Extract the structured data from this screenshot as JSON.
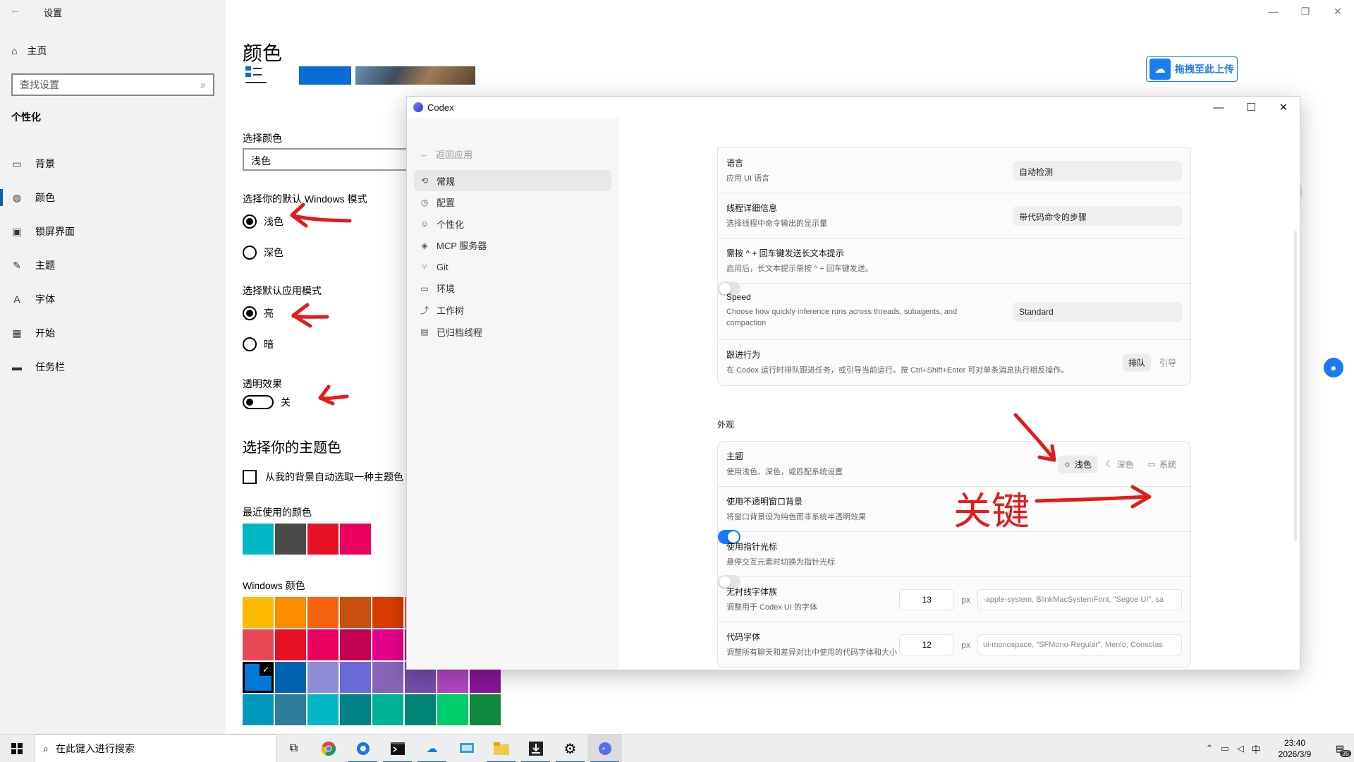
{
  "settings": {
    "window_title": "设置",
    "home": "主页",
    "search_placeholder": "查找设置",
    "section": "个性化",
    "nav": [
      {
        "label": "背景",
        "icon": "image-icon"
      },
      {
        "label": "颜色",
        "icon": "palette-icon",
        "active": true
      },
      {
        "label": "锁屏界面",
        "icon": "lock-screen-icon"
      },
      {
        "label": "主题",
        "icon": "theme-brush-icon"
      },
      {
        "label": "字体",
        "icon": "font-icon"
      },
      {
        "label": "开始",
        "icon": "start-tiles-icon"
      },
      {
        "label": "任务栏",
        "icon": "taskbar-icon"
      }
    ],
    "page_title": "颜色",
    "choose_color_label": "选择颜色",
    "choose_color_value": "浅色",
    "windows_mode_label": "选择你的默认 Windows 模式",
    "windows_mode_options": [
      "浅色",
      "深色"
    ],
    "app_mode_label": "选择默认应用模式",
    "app_mode_options": [
      "亮",
      "暗"
    ],
    "transparency_label": "透明效果",
    "transparency_state": "关",
    "accent_heading": "选择你的主题色",
    "auto_accent_label": "从我的背景自动选取一种主题色",
    "recent_colors_label": "最近使用的颜色",
    "recent_colors": [
      "#00b7c3",
      "#4c4a48",
      "#e81123",
      "#ea005e"
    ],
    "windows_colors_label": "Windows 颜色",
    "windows_colors": [
      [
        "#ffb900",
        "#ff8c00",
        "#f7630c",
        "#ca5010",
        "#da3b01",
        "#ef6950",
        "#d13438",
        "#ff4343"
      ],
      [
        "#e74856",
        "#e81123",
        "#ea005e",
        "#c30052",
        "#e3008c",
        "#bf0077",
        "#c239b3",
        "#9a0089"
      ],
      [
        "#0078d7",
        "#0063b1",
        "#8e8cd8",
        "#6b69d6",
        "#8764b8",
        "#744da9",
        "#b146c2",
        "#881798"
      ],
      [
        "#0099bc",
        "#2d7d9a",
        "#00b7c3",
        "#038387",
        "#00b294",
        "#018574",
        "#00cc6a",
        "#10893e"
      ]
    ],
    "upload_button": "拖拽至此上传"
  },
  "codex": {
    "title": "Codex",
    "back": "返回应用",
    "nav": [
      {
        "label": "常规",
        "icon": "general-icon",
        "active": true
      },
      {
        "label": "配置",
        "icon": "config-icon"
      },
      {
        "label": "个性化",
        "icon": "personalize-icon"
      },
      {
        "label": "MCP 服务器",
        "icon": "mcp-server-icon"
      },
      {
        "label": "Git",
        "icon": "git-branch-icon"
      },
      {
        "label": "环境",
        "icon": "environment-icon"
      },
      {
        "label": "工作树",
        "icon": "worktree-icon"
      },
      {
        "label": "已归档线程",
        "icon": "archive-icon"
      }
    ],
    "general_rows": [
      {
        "title": "语言",
        "desc": "应用 UI 语言",
        "control": "dropdown",
        "value": "自动检测"
      },
      {
        "title": "线程详细信息",
        "desc": "选择线程中命令输出的显示量",
        "control": "dropdown",
        "value": "带代码命令的步骤"
      },
      {
        "title": "需按 ^ + 回车键发送长文本提示",
        "desc": "启用后，长文本提示需按 ^ + 回车键发送。",
        "control": "toggle",
        "on": false
      },
      {
        "title": "Speed",
        "desc": "Choose how quickly inference runs across threads, subagents, and compaction",
        "control": "dropdown",
        "value": "Standard"
      },
      {
        "title": "跟进行为",
        "desc": "在 Codex 运行时排队跟进任务，或引导当前运行。按 Ctrl+Shift+Enter 可对单条消息执行相反操作。",
        "control": "segment",
        "options": [
          "排队",
          "引导"
        ],
        "selected": 0
      }
    ],
    "appearance_heading": "外观",
    "theme": {
      "title": "主题",
      "desc": "使用浅色、深色，或匹配系统设置",
      "options": [
        "浅色",
        "深色",
        "系统"
      ],
      "selected": 0
    },
    "opaque": {
      "title": "使用不透明窗口背景",
      "desc": "将窗口背景设为纯色而非系统半透明效果",
      "on": true
    },
    "pointer": {
      "title": "使用指针光标",
      "desc": "悬停交互元素时切换为指针光标",
      "on": false
    },
    "sans_font": {
      "title": "无衬线字体族",
      "desc": "调整用于 Codex UI 的字体",
      "size": "13",
      "unit": "px",
      "family": "-apple-system, BlinkMacSystemFont, \"Segoe UI\", sa"
    },
    "code_font": {
      "title": "代码字体",
      "desc": "调整所有聊天和差异对比中使用的代码字体和大小",
      "size": "12",
      "unit": "px",
      "family": "ui-monospace, \"SFMono-Regular\", Menlo, Consolas"
    }
  },
  "annotation": {
    "label": "关键",
    "color": "#e51a1a"
  },
  "taskbar": {
    "search_placeholder": "在此键入进行搜索",
    "apps": [
      "task-view-icon",
      "chrome-icon",
      "blue-circle-app-icon",
      "terminal-icon",
      "baidu-netdisk-icon",
      "remote-desktop-icon",
      "file-explorer-icon",
      "download-app-icon",
      "settings-gear-icon",
      "codex-app-icon"
    ],
    "time": "23:40",
    "date": "2026/3/9",
    "notification_count": "35",
    "ime": "中"
  }
}
